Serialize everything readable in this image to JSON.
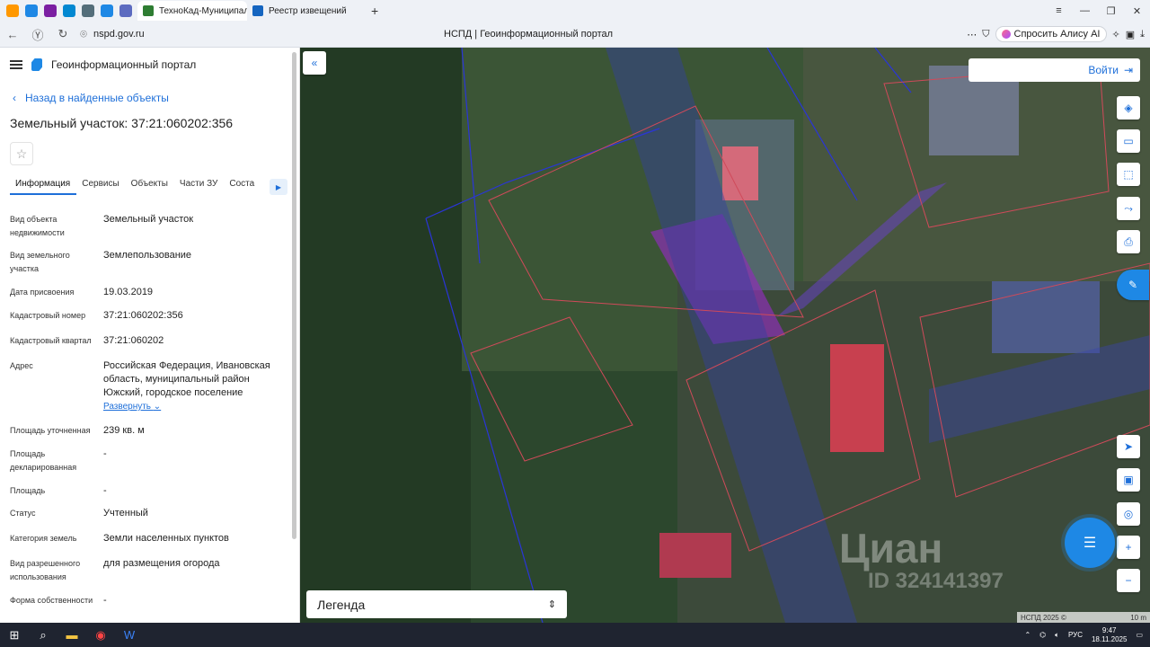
{
  "browser": {
    "tabs": [
      {
        "label": "ТехноКад-Муниципалите",
        "color": "#2e7d32"
      },
      {
        "label": "Реестр извещений",
        "color": "#1565c0"
      }
    ],
    "url": "nspd.gov.ru",
    "page_title": "НСПД | Геоинформационный портал",
    "alice_label": "Спросить Алису AI"
  },
  "sidebar": {
    "portal_title": "Геоинформационный портал",
    "back_label": "Назад в найденные объекты",
    "object_title": "Земельный участок: 37:21:060202:356",
    "tabs": [
      "Информация",
      "Сервисы",
      "Объекты",
      "Части ЗУ",
      "Соста"
    ],
    "rows": [
      {
        "k": "Вид объекта недвижимости",
        "v": "Земельный участок"
      },
      {
        "k": "Вид земельного участка",
        "v": "Землепользование"
      },
      {
        "k": "Дата присвоения",
        "v": "19.03.2019"
      },
      {
        "k": "Кадастровый номер",
        "v": "37:21:060202:356"
      },
      {
        "k": "Кадастровый квартал",
        "v": "37:21:060202"
      },
      {
        "k": "Адрес",
        "v": "Российская Федерация, Ивановская область, муниципальный район Южский, городское поселение"
      },
      {
        "k": "Площадь уточненная",
        "v": "239 кв. м"
      },
      {
        "k": "Площадь декларированная",
        "v": "-"
      },
      {
        "k": "Площадь",
        "v": "-"
      },
      {
        "k": "Статус",
        "v": "Учтенный"
      },
      {
        "k": "Категория земель",
        "v": "Земли населенных пунктов"
      },
      {
        "k": "Вид разрешенного использования",
        "v": "для размещения огорода"
      },
      {
        "k": "Форма собственности",
        "v": "-"
      }
    ],
    "expand_label": "Развернуть"
  },
  "map": {
    "login_label": "Войти",
    "legend_label": "Легенда",
    "watermark": "Циан",
    "watermark_id": "ID 324141397",
    "copyright": "НСПД 2025 ©",
    "scale": "10 m"
  },
  "taskbar": {
    "lang": "РУС",
    "time": "9:47",
    "date": "18.11.2025"
  }
}
